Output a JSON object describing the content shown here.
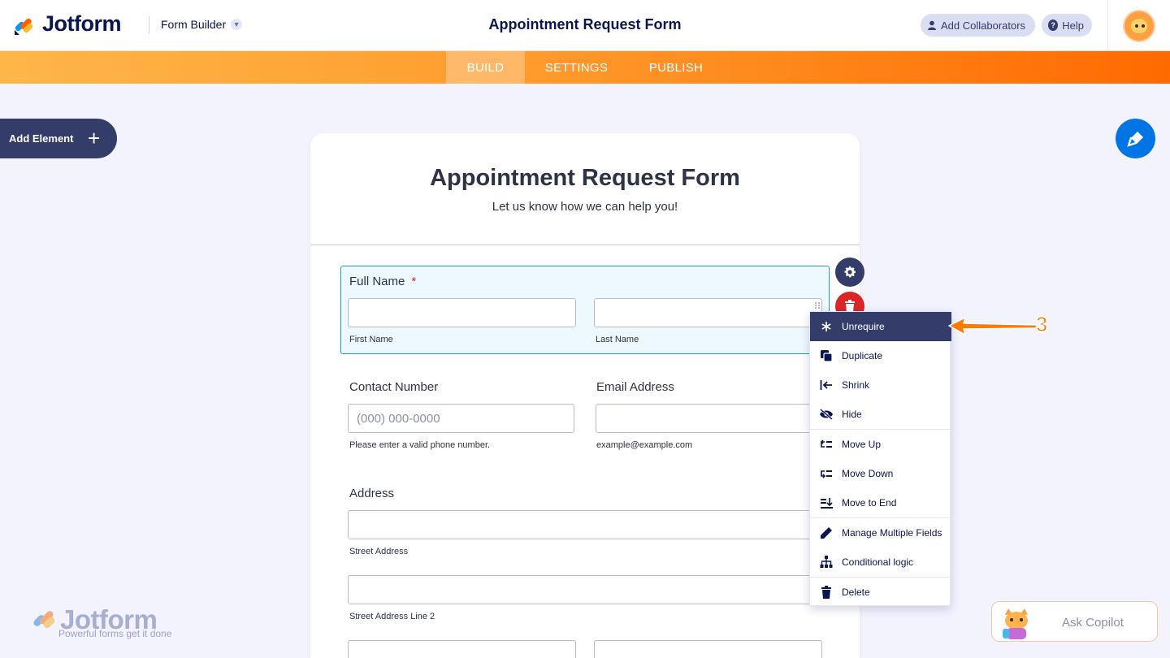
{
  "header": {
    "brand": "Jotform",
    "builder_label": "Form Builder",
    "title": "Appointment Request Form",
    "collaborators_label": "Add Collaborators",
    "help_label": "Help"
  },
  "nav": {
    "tabs": [
      {
        "label": "BUILD",
        "active": true
      },
      {
        "label": "SETTINGS",
        "active": false
      },
      {
        "label": "PUBLISH",
        "active": false
      }
    ]
  },
  "sidebar": {
    "add_element_label": "Add Element"
  },
  "form": {
    "title": "Appointment Request Form",
    "subtitle": "Let us know how we can help you!",
    "full_name": {
      "label": "Full Name",
      "required_mark": "*",
      "first_sublabel": "First Name",
      "last_sublabel": "Last Name"
    },
    "contact": {
      "label": "Contact Number",
      "placeholder": "(000) 000-0000",
      "sublabel": "Please enter a valid phone number."
    },
    "email": {
      "label": "Email Address",
      "sublabel": "example@example.com"
    },
    "address": {
      "label": "Address",
      "street_sublabel": "Street Address",
      "street2_sublabel": "Street Address Line 2"
    }
  },
  "context_menu": {
    "items": [
      {
        "label": "Unrequire",
        "icon": "asterisk-icon",
        "active": true
      },
      {
        "label": "Duplicate",
        "icon": "duplicate-icon"
      },
      {
        "label": "Shrink",
        "icon": "shrink-icon"
      },
      {
        "label": "Hide",
        "icon": "eye-off-icon"
      },
      {
        "label": "Move Up",
        "icon": "move-up-icon"
      },
      {
        "label": "Move Down",
        "icon": "move-down-icon"
      },
      {
        "label": "Move to End",
        "icon": "move-end-icon"
      },
      {
        "label": "Manage Multiple Fields",
        "icon": "pencil-icon"
      },
      {
        "label": "Conditional logic",
        "icon": "sitemap-icon"
      },
      {
        "label": "Delete",
        "icon": "trash-icon"
      }
    ]
  },
  "annotation": {
    "step": "3"
  },
  "watermark": {
    "brand": "Jotform",
    "tagline": "Powerful forms get it done"
  },
  "copilot": {
    "label": "Ask Copilot"
  },
  "colors": {
    "navy": "#0a1551",
    "button_dark": "#343c6a",
    "orange_start": "#ffb648",
    "orange_end": "#ff6a00",
    "accent_blue": "#0075e3",
    "danger": "#dc2626",
    "selected_border": "#1ba2a8",
    "selected_bg": "#edf8ff"
  }
}
